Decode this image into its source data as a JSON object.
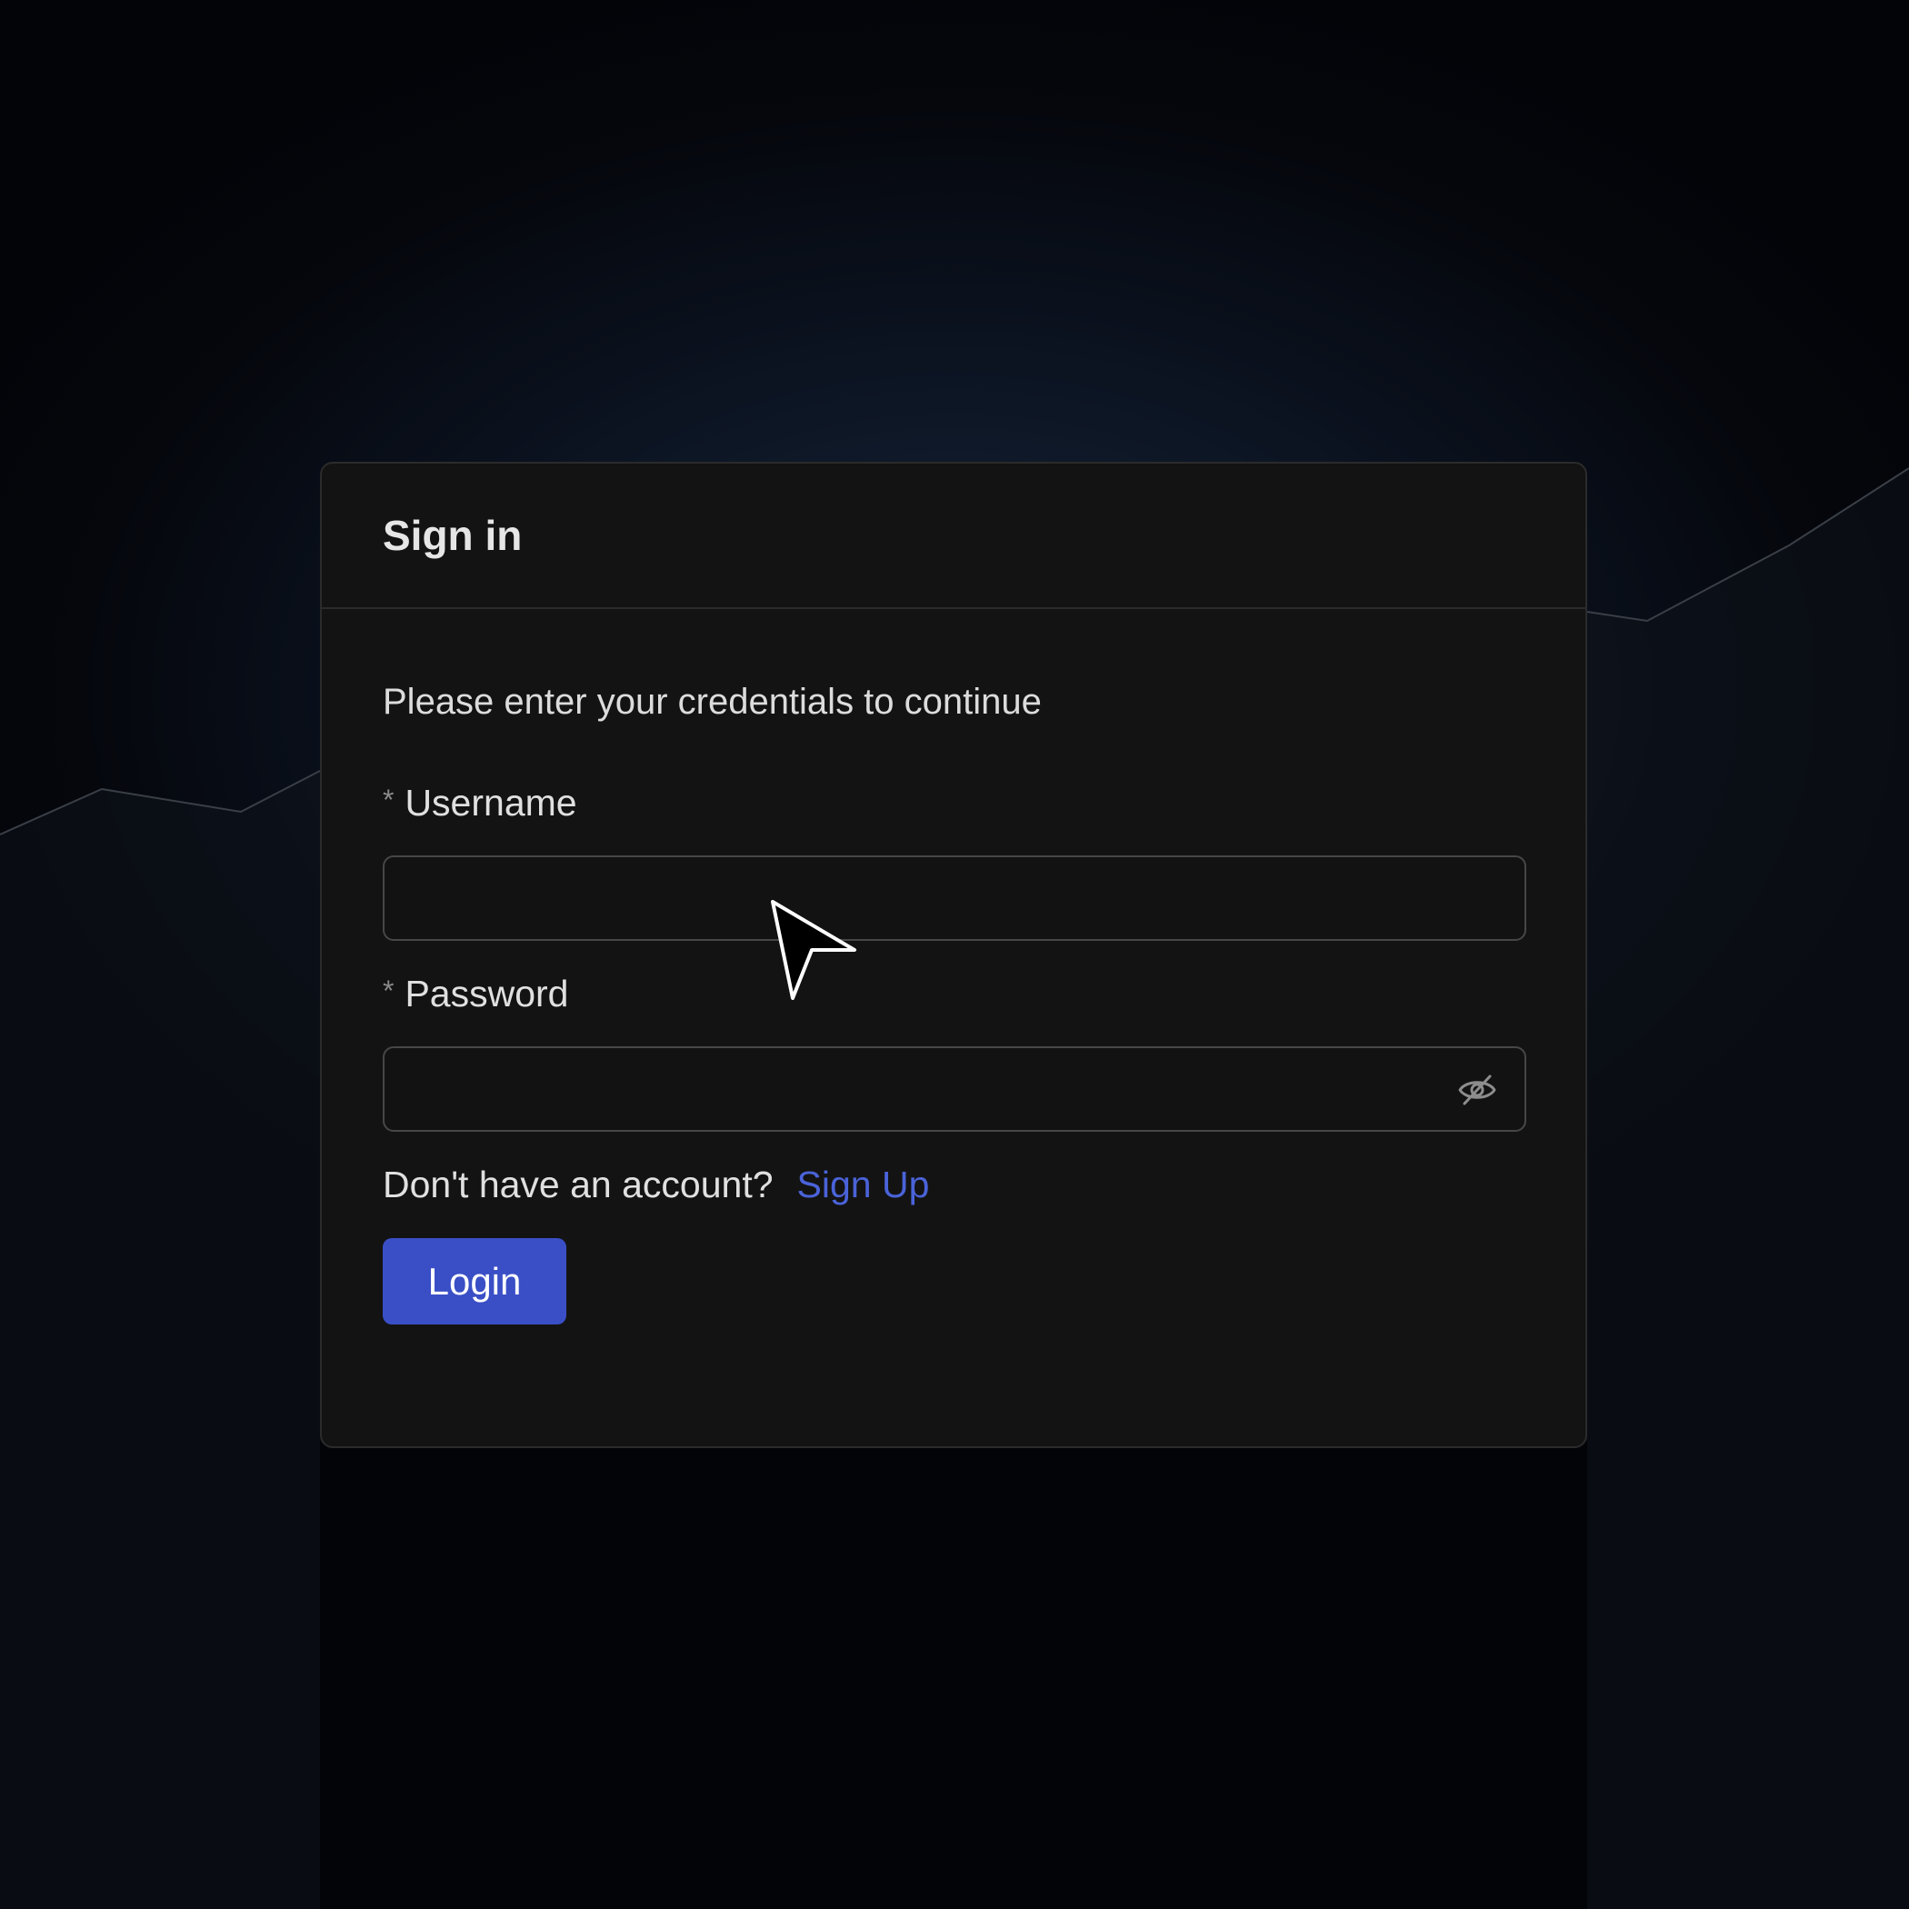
{
  "card": {
    "title": "Sign in",
    "subtitle": "Please enter your credentials to continue"
  },
  "form": {
    "username": {
      "required_mark": "*",
      "label": "Username",
      "value": "",
      "placeholder": ""
    },
    "password": {
      "required_mark": "*",
      "label": "Password",
      "value": "",
      "placeholder": "",
      "toggle_icon": "eye-off-icon"
    },
    "signup_prompt": "Don't have an account?",
    "signup_link": "Sign Up",
    "login_label": "Login"
  },
  "colors": {
    "accent": "#3a4fc6",
    "link": "#4a63d9",
    "card_bg": "#131313",
    "border": "#474747"
  }
}
